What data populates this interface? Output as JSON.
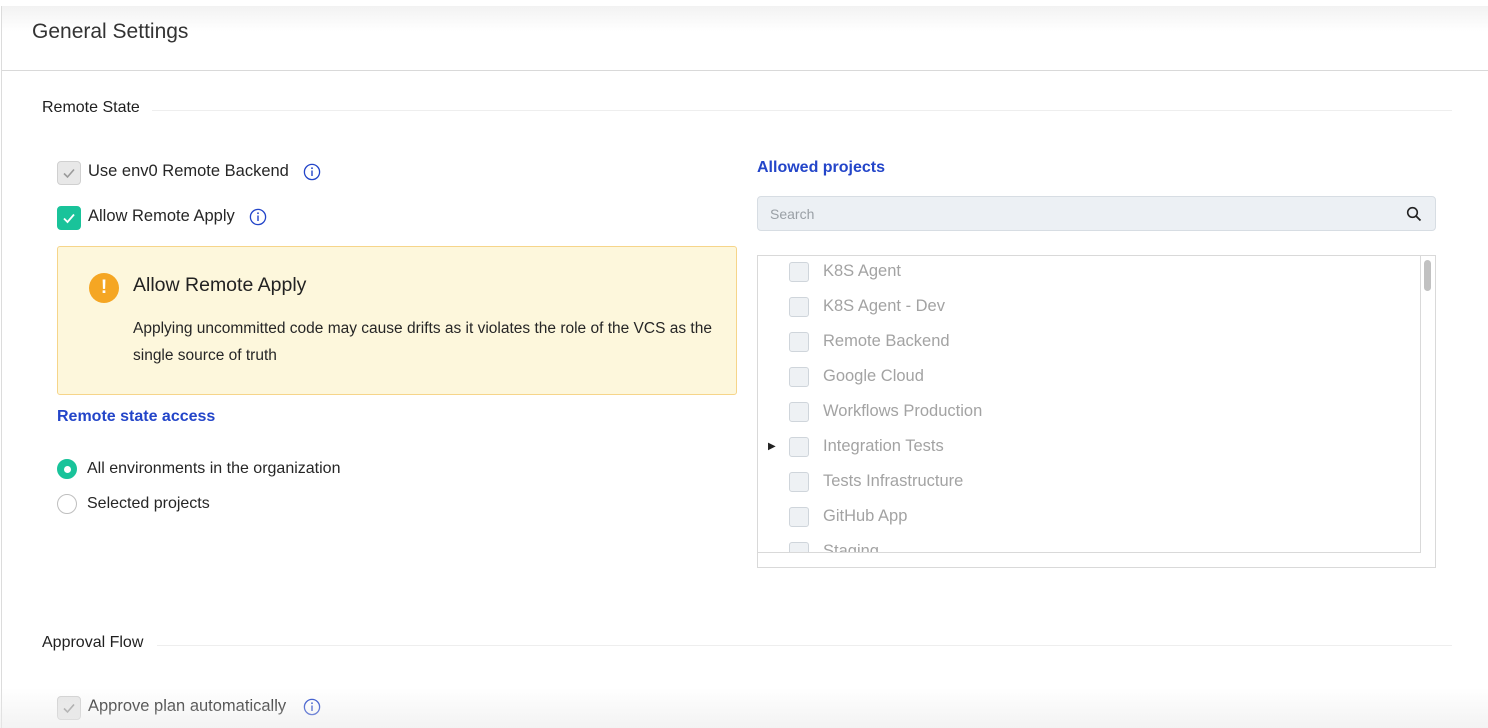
{
  "header": {
    "title": "General Settings"
  },
  "remote_state": {
    "section_title": "Remote State",
    "use_backend_label": "Use env0 Remote Backend",
    "use_backend_checked": true,
    "allow_apply_label": "Allow Remote Apply",
    "allow_apply_checked": true,
    "warning": {
      "title": "Allow Remote Apply",
      "text": "Applying uncommitted code may cause drifts as it violates the role of the VCS as the single source of truth"
    },
    "access_title": "Remote state access",
    "access_options": [
      {
        "label": "All environments in the organization",
        "selected": true
      },
      {
        "label": "Selected projects",
        "selected": false
      }
    ]
  },
  "allowed_projects": {
    "title": "Allowed projects",
    "search_placeholder": "Search",
    "projects": [
      {
        "label": "K8S Agent",
        "expandable": false
      },
      {
        "label": "K8S Agent - Dev",
        "expandable": false
      },
      {
        "label": "Remote Backend",
        "expandable": false
      },
      {
        "label": "Google Cloud",
        "expandable": false
      },
      {
        "label": "Workflows Production",
        "expandable": false
      },
      {
        "label": "Integration Tests",
        "expandable": true
      },
      {
        "label": "Tests Infrastructure",
        "expandable": false
      },
      {
        "label": "GitHub App",
        "expandable": false
      },
      {
        "label": "Staging",
        "expandable": false
      }
    ]
  },
  "approval_flow": {
    "section_title": "Approval Flow",
    "auto_approve_label": "Approve plan automatically",
    "auto_approve_checked": true
  },
  "colors": {
    "accent_green": "#19c39a",
    "link_blue": "#2345c9",
    "warning_bg": "#fdf7dc",
    "warning_icon": "#f5a623"
  }
}
